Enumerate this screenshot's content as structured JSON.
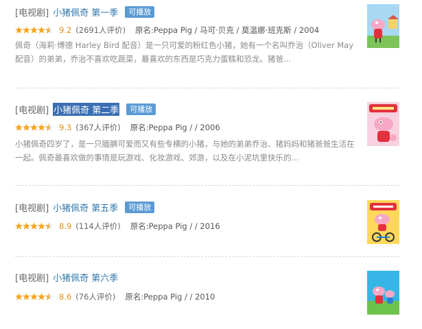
{
  "items": [
    {
      "category": "[电视剧]",
      "title": "小猪佩奇 第一季",
      "badge": "可播放",
      "score": "9.2",
      "rating_count": "(2691人评价)",
      "original": "原名:Peppa Pig / 马可·贝克 / 莫温娜·班克斯 / 2004",
      "description": "佩奇（海莉·博德 Harley Bird 配音）是一只可爱的粉红色小猪，她有一个名叫乔治（Oliver May 配音）的弟弟，乔治不喜欢吃蔬菜，最喜欢的东西是巧克力蛋糕和恐龙。猪爸...",
      "stars": 4.5,
      "poster_icon": "peppa-poster-icon"
    },
    {
      "category": "[电视剧]",
      "title": "小猪佩奇 第二季",
      "badge": "可播放",
      "score": "9.3",
      "rating_count": "(367人评价)",
      "original": "原名:Peppa Pig / / 2006",
      "description": "小猪佩奇四岁了，是一只腼腆可爱而又有些专横的小猪，与她的弟弟乔治、猪妈妈和猪爸爸生活在一起。佩奇最喜欢做的事情是玩游戏、化妆游戏、郊游，以及在小泥坑里快乐的...",
      "stars": 4.5,
      "poster_icon": "peppa-poster-icon"
    },
    {
      "category": "[电视剧]",
      "title": "小猪佩奇 第五季",
      "badge": "可播放",
      "score": "8.9",
      "rating_count": "(114人评价)",
      "original": "原名:Peppa Pig / / 2016",
      "description": "",
      "stars": 4.5,
      "poster_icon": "peppa-poster-icon"
    },
    {
      "category": "[电视剧]",
      "title": "小猪佩奇 第六季",
      "badge": "",
      "score": "8.6",
      "rating_count": "(76人评价)",
      "original": "原名:Peppa Pig / / 2010",
      "description": "",
      "stars": 4.5,
      "poster_icon": "peppa-poster-icon"
    }
  ],
  "colors": {
    "link": "#3377aa",
    "badge": "#5b9bd5",
    "star": "#f5a623",
    "score": "#e09015",
    "highlight": "#3a6fb4"
  }
}
